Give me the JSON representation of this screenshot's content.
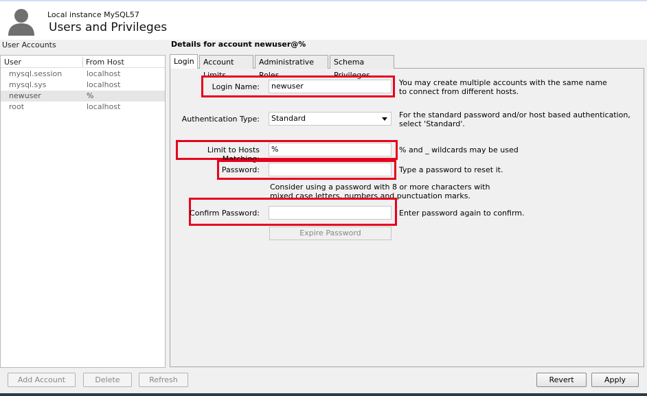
{
  "header": {
    "instance": "Local instance MySQL57",
    "title": "Users and Privileges"
  },
  "accounts": {
    "title": "User Accounts",
    "columns": [
      "User",
      "From Host"
    ],
    "rows": [
      {
        "user": "mysql.session",
        "host": "localhost"
      },
      {
        "user": "mysql.sys",
        "host": "localhost"
      },
      {
        "user": "newuser",
        "host": "%"
      },
      {
        "user": "root",
        "host": "localhost"
      }
    ],
    "selected_index": 2
  },
  "buttons": {
    "add": "Add Account",
    "delete": "Delete",
    "refresh": "Refresh",
    "revert": "Revert",
    "apply": "Apply"
  },
  "details": {
    "title": "Details for account newuser@%",
    "tabs": [
      "Login",
      "Account Limits",
      "Administrative Roles",
      "Schema Privileges"
    ],
    "active_tab": "Login"
  },
  "login": {
    "login_name_label": "Login Name:",
    "login_name_value": "newuser",
    "login_name_hint_1": "You may create multiple accounts with the same name",
    "login_name_hint_2": "to connect from different hosts.",
    "auth_label": "Authentication Type:",
    "auth_value": "Standard",
    "auth_hint_1": "For the standard password and/or host based authentication,",
    "auth_hint_2": "select 'Standard'.",
    "hosts_label": "Limit to Hosts Matching:",
    "hosts_value": "%",
    "hosts_hint": "% and _ wildcards may be used",
    "password_label": "Password:",
    "password_value": "",
    "password_hint": "Type a password to reset it.",
    "password_advice_1": "Consider using a password with 8 or more characters with",
    "password_advice_2": "mixed case letters, numbers and punctuation marks.",
    "confirm_label": "Confirm Password:",
    "confirm_value": "",
    "confirm_hint": "Enter password again to confirm.",
    "expire_button": "Expire Password"
  },
  "colors": {
    "highlight_box": "#e8001c",
    "selected_row": "#e6e6e6"
  }
}
